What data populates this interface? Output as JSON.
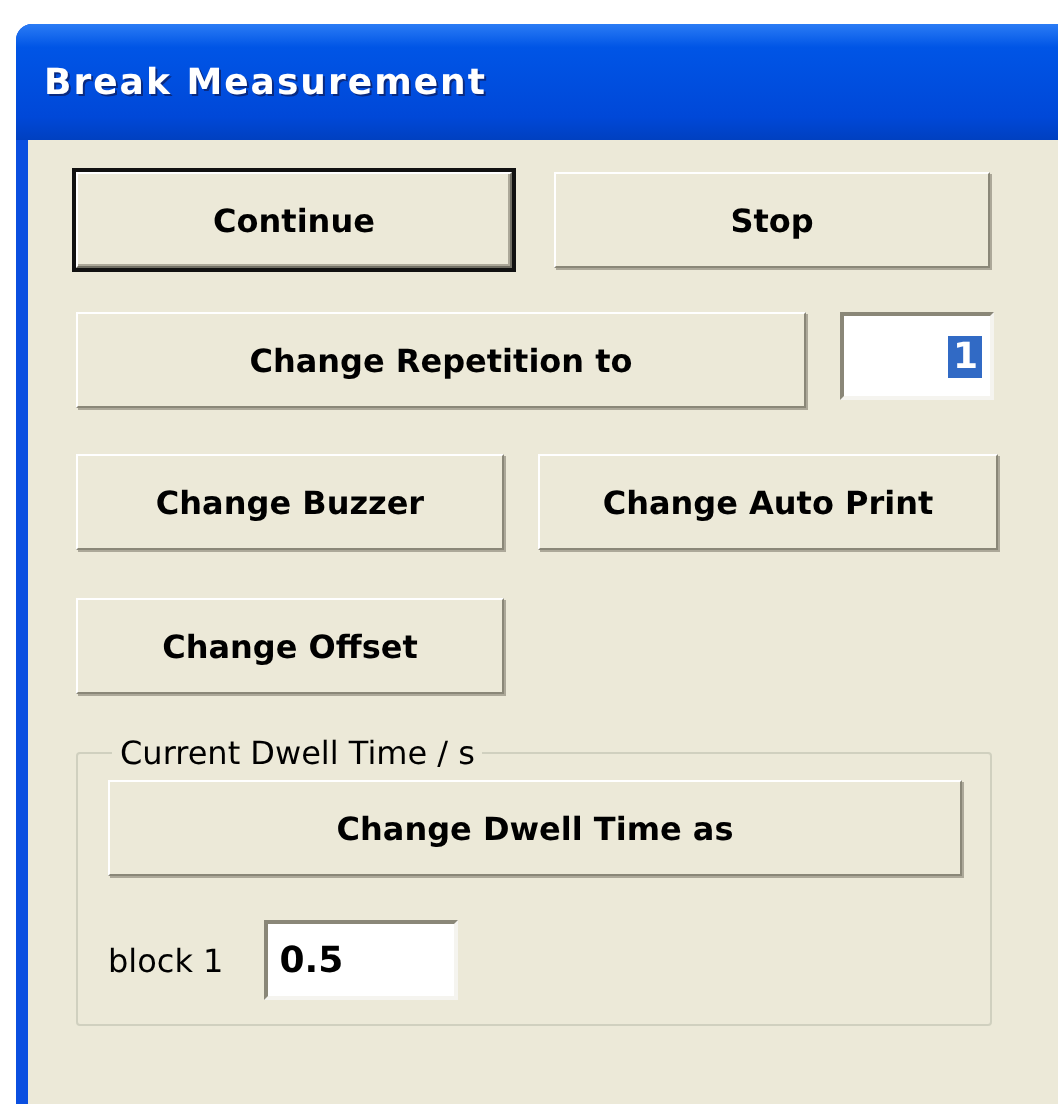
{
  "window": {
    "title": "Break Measurement"
  },
  "rows": [
    {
      "kind": "buttons",
      "buttons": [
        {
          "label": "Continue",
          "default": true
        },
        {
          "label": "Stop",
          "default": false
        }
      ]
    },
    {
      "kind": "button-field",
      "buttons": [
        {
          "label": "Change Repetition to",
          "default": false
        }
      ],
      "field": {
        "value": "1",
        "selected": true
      }
    },
    {
      "kind": "buttons",
      "buttons": [
        {
          "label": "Change Buzzer",
          "default": false
        },
        {
          "label": "Change Auto Print",
          "default": false
        }
      ]
    },
    {
      "kind": "buttons",
      "buttons": [
        {
          "label": "Change Offset",
          "default": false
        }
      ]
    }
  ],
  "group": {
    "legend": "Current Dwell Time / s",
    "button": {
      "label": "Change Dwell Time as",
      "default": false
    },
    "field_label": "block 1",
    "field": {
      "value": "0.5",
      "selected": false
    }
  }
}
